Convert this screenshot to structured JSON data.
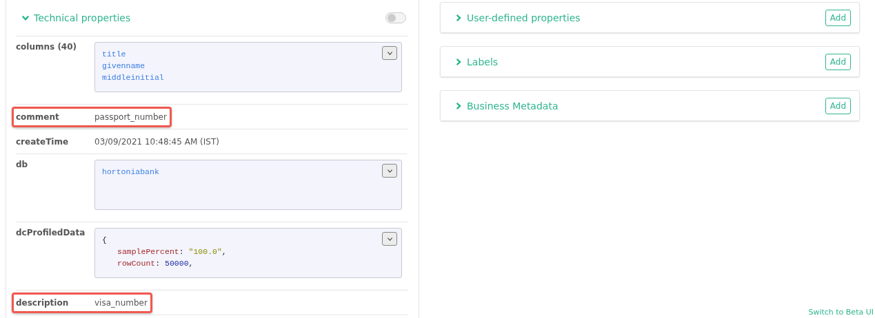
{
  "technical_properties": {
    "title": "Technical properties",
    "expanded": true,
    "toggle": {
      "on": false
    },
    "rows": [
      {
        "kind": "code",
        "label": "columns (40)",
        "lines": [
          [
            {
              "text": "title",
              "kind": "plain"
            }
          ],
          [
            {
              "text": "givenname",
              "kind": "plain"
            }
          ],
          [
            {
              "text": "middleinitial",
              "kind": "plain"
            }
          ]
        ]
      },
      {
        "kind": "text",
        "label": "comment",
        "value": "passport_number",
        "highlighted": true
      },
      {
        "kind": "text",
        "label": "createTime",
        "value": "03/09/2021 10:48:45 AM (IST)",
        "highlighted": false
      },
      {
        "kind": "code",
        "label": "db",
        "lines": [
          [
            {
              "text": "hortoniabank",
              "kind": "plain"
            }
          ]
        ]
      },
      {
        "kind": "code",
        "label": "dcProfiledData",
        "lines": [
          [
            {
              "text": "{",
              "kind": "punct"
            }
          ],
          [
            {
              "text": "samplePercent",
              "kind": "key"
            },
            {
              "text": ": ",
              "kind": "punct"
            },
            {
              "text": "\"100.0\"",
              "kind": "string"
            },
            {
              "text": ",",
              "kind": "punct"
            }
          ],
          [
            {
              "text": "rowCount",
              "kind": "key"
            },
            {
              "text": ": ",
              "kind": "punct"
            },
            {
              "text": "50000",
              "kind": "number"
            },
            {
              "text": ",",
              "kind": "punct"
            }
          ]
        ]
      },
      {
        "kind": "text",
        "label": "description",
        "value": "visa_number",
        "highlighted": true
      }
    ]
  },
  "sections": [
    {
      "title": "User-defined properties",
      "expanded": false,
      "button": "Add"
    },
    {
      "title": "Labels",
      "expanded": false,
      "button": "Add"
    },
    {
      "title": "Business Metadata",
      "expanded": false,
      "button": "Add"
    }
  ],
  "footer_link": "Switch to Beta UI"
}
